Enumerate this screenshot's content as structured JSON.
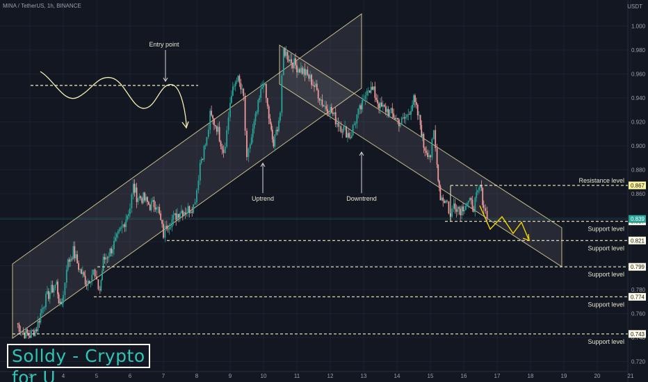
{
  "header": {
    "symbol_line": "MINA / TetherUS, 1h, BINANCE",
    "unit": "USDT"
  },
  "brand": "Solldy - Crypto for U",
  "colors": {
    "background": "#131722",
    "up": "#26a69a",
    "down": "#ef9a9a",
    "channel": "#f2e6a0",
    "annotation": "#f7f1b5",
    "arrow": "#f5d500"
  },
  "chart_data": {
    "type": "candlestick",
    "x_ticks": [
      "3",
      "4",
      "5",
      "6",
      "7",
      "8",
      "9",
      "10",
      "11",
      "12",
      "13",
      "14",
      "15",
      "16",
      "17",
      "18",
      "19",
      "20",
      "21"
    ],
    "y_ticks": [
      "1.000",
      "0.980",
      "0.960",
      "0.940",
      "0.920",
      "0.900",
      "0.880",
      "0.860",
      "0.840",
      "0.820",
      "0.800",
      "0.780",
      "0.760",
      "0.740",
      "0.720"
    ],
    "ylim": [
      0.715,
      1.02
    ],
    "ohlc_path": [
      [
        2.6,
        0.752
      ],
      [
        2.8,
        0.744
      ],
      [
        3.0,
        0.742
      ],
      [
        3.2,
        0.748
      ],
      [
        3.4,
        0.768
      ],
      [
        3.6,
        0.778
      ],
      [
        3.8,
        0.785
      ],
      [
        3.9,
        0.765
      ],
      [
        4.0,
        0.775
      ],
      [
        4.1,
        0.8
      ],
      [
        4.3,
        0.812
      ],
      [
        4.5,
        0.796
      ],
      [
        4.7,
        0.786
      ],
      [
        4.9,
        0.795
      ],
      [
        5.0,
        0.784
      ],
      [
        5.1,
        0.78
      ],
      [
        5.2,
        0.804
      ],
      [
        5.4,
        0.812
      ],
      [
        5.6,
        0.822
      ],
      [
        5.8,
        0.834
      ],
      [
        6.0,
        0.849
      ],
      [
        6.1,
        0.866
      ],
      [
        6.2,
        0.858
      ],
      [
        6.4,
        0.856
      ],
      [
        6.6,
        0.85
      ],
      [
        6.8,
        0.852
      ],
      [
        7.0,
        0.826
      ],
      [
        7.1,
        0.834
      ],
      [
        7.3,
        0.839
      ],
      [
        7.5,
        0.846
      ],
      [
        7.7,
        0.846
      ],
      [
        7.9,
        0.85
      ],
      [
        8.0,
        0.864
      ],
      [
        8.1,
        0.886
      ],
      [
        8.3,
        0.905
      ],
      [
        8.4,
        0.925
      ],
      [
        8.6,
        0.916
      ],
      [
        8.8,
        0.896
      ],
      [
        8.9,
        0.912
      ],
      [
        9.0,
        0.937
      ],
      [
        9.2,
        0.958
      ],
      [
        9.4,
        0.94
      ],
      [
        9.5,
        0.886
      ],
      [
        9.6,
        0.902
      ],
      [
        9.8,
        0.928
      ],
      [
        10.0,
        0.955
      ],
      [
        10.2,
        0.916
      ],
      [
        10.3,
        0.9
      ],
      [
        10.5,
        0.928
      ],
      [
        10.6,
        0.98
      ],
      [
        10.8,
        0.972
      ],
      [
        11.0,
        0.966
      ],
      [
        11.2,
        0.962
      ],
      [
        11.4,
        0.956
      ],
      [
        11.6,
        0.946
      ],
      [
        11.8,
        0.934
      ],
      [
        12.0,
        0.93
      ],
      [
        12.2,
        0.92
      ],
      [
        12.4,
        0.914
      ],
      [
        12.6,
        0.908
      ],
      [
        12.8,
        0.925
      ],
      [
        13.0,
        0.936
      ],
      [
        13.1,
        0.95
      ],
      [
        13.3,
        0.945
      ],
      [
        13.5,
        0.932
      ],
      [
        13.7,
        0.93
      ],
      [
        13.9,
        0.925
      ],
      [
        14.1,
        0.919
      ],
      [
        14.3,
        0.925
      ],
      [
        14.5,
        0.938
      ],
      [
        14.7,
        0.918
      ],
      [
        14.8,
        0.9
      ],
      [
        15.0,
        0.892
      ],
      [
        15.1,
        0.91
      ],
      [
        15.2,
        0.884
      ],
      [
        15.3,
        0.858
      ],
      [
        15.5,
        0.853
      ],
      [
        15.6,
        0.84
      ],
      [
        15.7,
        0.852
      ],
      [
        15.9,
        0.847
      ],
      [
        16.1,
        0.853
      ],
      [
        16.3,
        0.85
      ],
      [
        16.5,
        0.866
      ],
      [
        16.6,
        0.85
      ],
      [
        16.7,
        0.839
      ]
    ],
    "trendlines": [
      "Uptrend",
      "Downtrend"
    ],
    "annotations": {
      "entry": "Entry point",
      "uptrend": "Uptrend",
      "downtrend": "Downtrend",
      "resistance": "Resistance level",
      "support": "Support level"
    },
    "levels": [
      {
        "value": 0.867,
        "tag": "0.867",
        "label": "Resistance level",
        "kind": "resistance"
      },
      {
        "value": 0.837,
        "tag": "0.837",
        "label": "Support level",
        "kind": "support"
      },
      {
        "value": 0.821,
        "tag": "0.821",
        "label": "Support level",
        "kind": "support"
      },
      {
        "value": 0.799,
        "tag": "0.799",
        "label": "Support level",
        "kind": "support"
      },
      {
        "value": 0.774,
        "tag": "0.774",
        "label": "Support level",
        "kind": "support"
      },
      {
        "value": 0.743,
        "tag": "0.743",
        "label": "Support level",
        "kind": "support"
      }
    ],
    "last_price": "0.839",
    "last_price_value": 0.839
  }
}
